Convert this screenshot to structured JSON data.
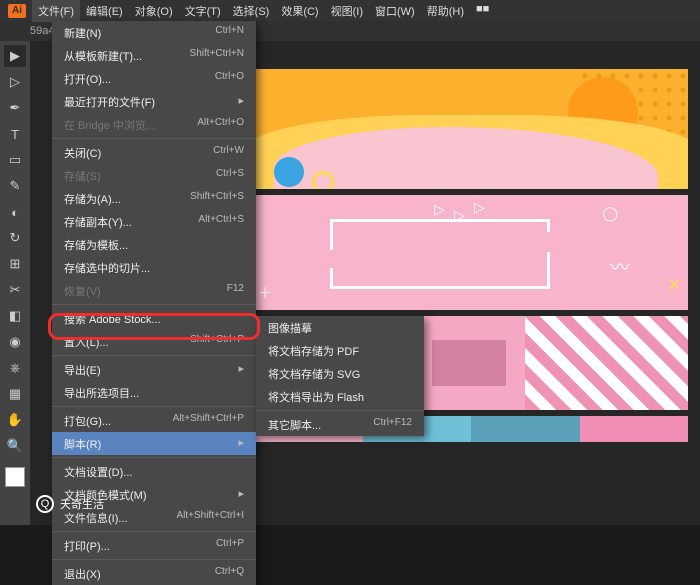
{
  "menubar": [
    "文件(F)",
    "编辑(E)",
    "对象(O)",
    "文字(T)",
    "选择(S)",
    "效果(C)",
    "视图(I)",
    "窗口(W)",
    "帮助(H)",
    "■■"
  ],
  "active_menu_index": 0,
  "tab_label": "59a4...",
  "dropdown": [
    {
      "label": "新建(N)",
      "sc": "Ctrl+N"
    },
    {
      "label": "从模板新建(T)...",
      "sc": "Shift+Ctrl+N"
    },
    {
      "label": "打开(O)...",
      "sc": "Ctrl+O"
    },
    {
      "label": "最近打开的文件(F)",
      "arrow": true
    },
    {
      "label": "在 Bridge 中浏览...",
      "sc": "Alt+Ctrl+O",
      "disabled": true
    },
    {
      "sep": true
    },
    {
      "label": "关闭(C)",
      "sc": "Ctrl+W"
    },
    {
      "label": "存储(S)",
      "sc": "Ctrl+S",
      "disabled": true
    },
    {
      "label": "存储为(A)...",
      "sc": "Shift+Ctrl+S"
    },
    {
      "label": "存储副本(Y)...",
      "sc": "Alt+Ctrl+S"
    },
    {
      "label": "存储为模板..."
    },
    {
      "label": "存储选中的切片..."
    },
    {
      "label": "恢复(V)",
      "sc": "F12",
      "disabled": true
    },
    {
      "sep": true
    },
    {
      "label": "搜索 Adobe Stock..."
    },
    {
      "label": "置入(L)...",
      "sc": "Shift+Ctrl+P"
    },
    {
      "sep": true
    },
    {
      "label": "导出(E)",
      "arrow": true
    },
    {
      "label": "导出所选项目..."
    },
    {
      "sep": true
    },
    {
      "label": "打包(G)...",
      "sc": "Alt+Shift+Ctrl+P"
    },
    {
      "label": "脚本(R)",
      "arrow": true,
      "hl": true
    },
    {
      "sep": true
    },
    {
      "label": "文档设置(D)...",
      "sc": ""
    },
    {
      "label": "文档颜色模式(M)",
      "arrow": true
    },
    {
      "label": "文件信息(I)...",
      "sc": "Alt+Shift+Ctrl+I"
    },
    {
      "sep": true
    },
    {
      "label": "打印(P)...",
      "sc": "Ctrl+P"
    },
    {
      "sep": true
    },
    {
      "label": "退出(X)",
      "sc": "Ctrl+Q"
    }
  ],
  "submenu": [
    {
      "label": "图像描摹"
    },
    {
      "label": "将文档存储为 PDF"
    },
    {
      "label": "将文档存储为 SVG"
    },
    {
      "label": "将文档导出为 Flash"
    },
    {
      "sep": true
    },
    {
      "label": "其它脚本...",
      "sc": "Ctrl+F12"
    }
  ],
  "watermark": "天奇生活",
  "tools": [
    "▶",
    "▷",
    "✒",
    "T",
    "▭",
    "✎",
    "◐",
    "↻",
    "⊞",
    "✂",
    "◧",
    "◉",
    "⎈",
    "▦",
    "✋",
    "🔍"
  ]
}
